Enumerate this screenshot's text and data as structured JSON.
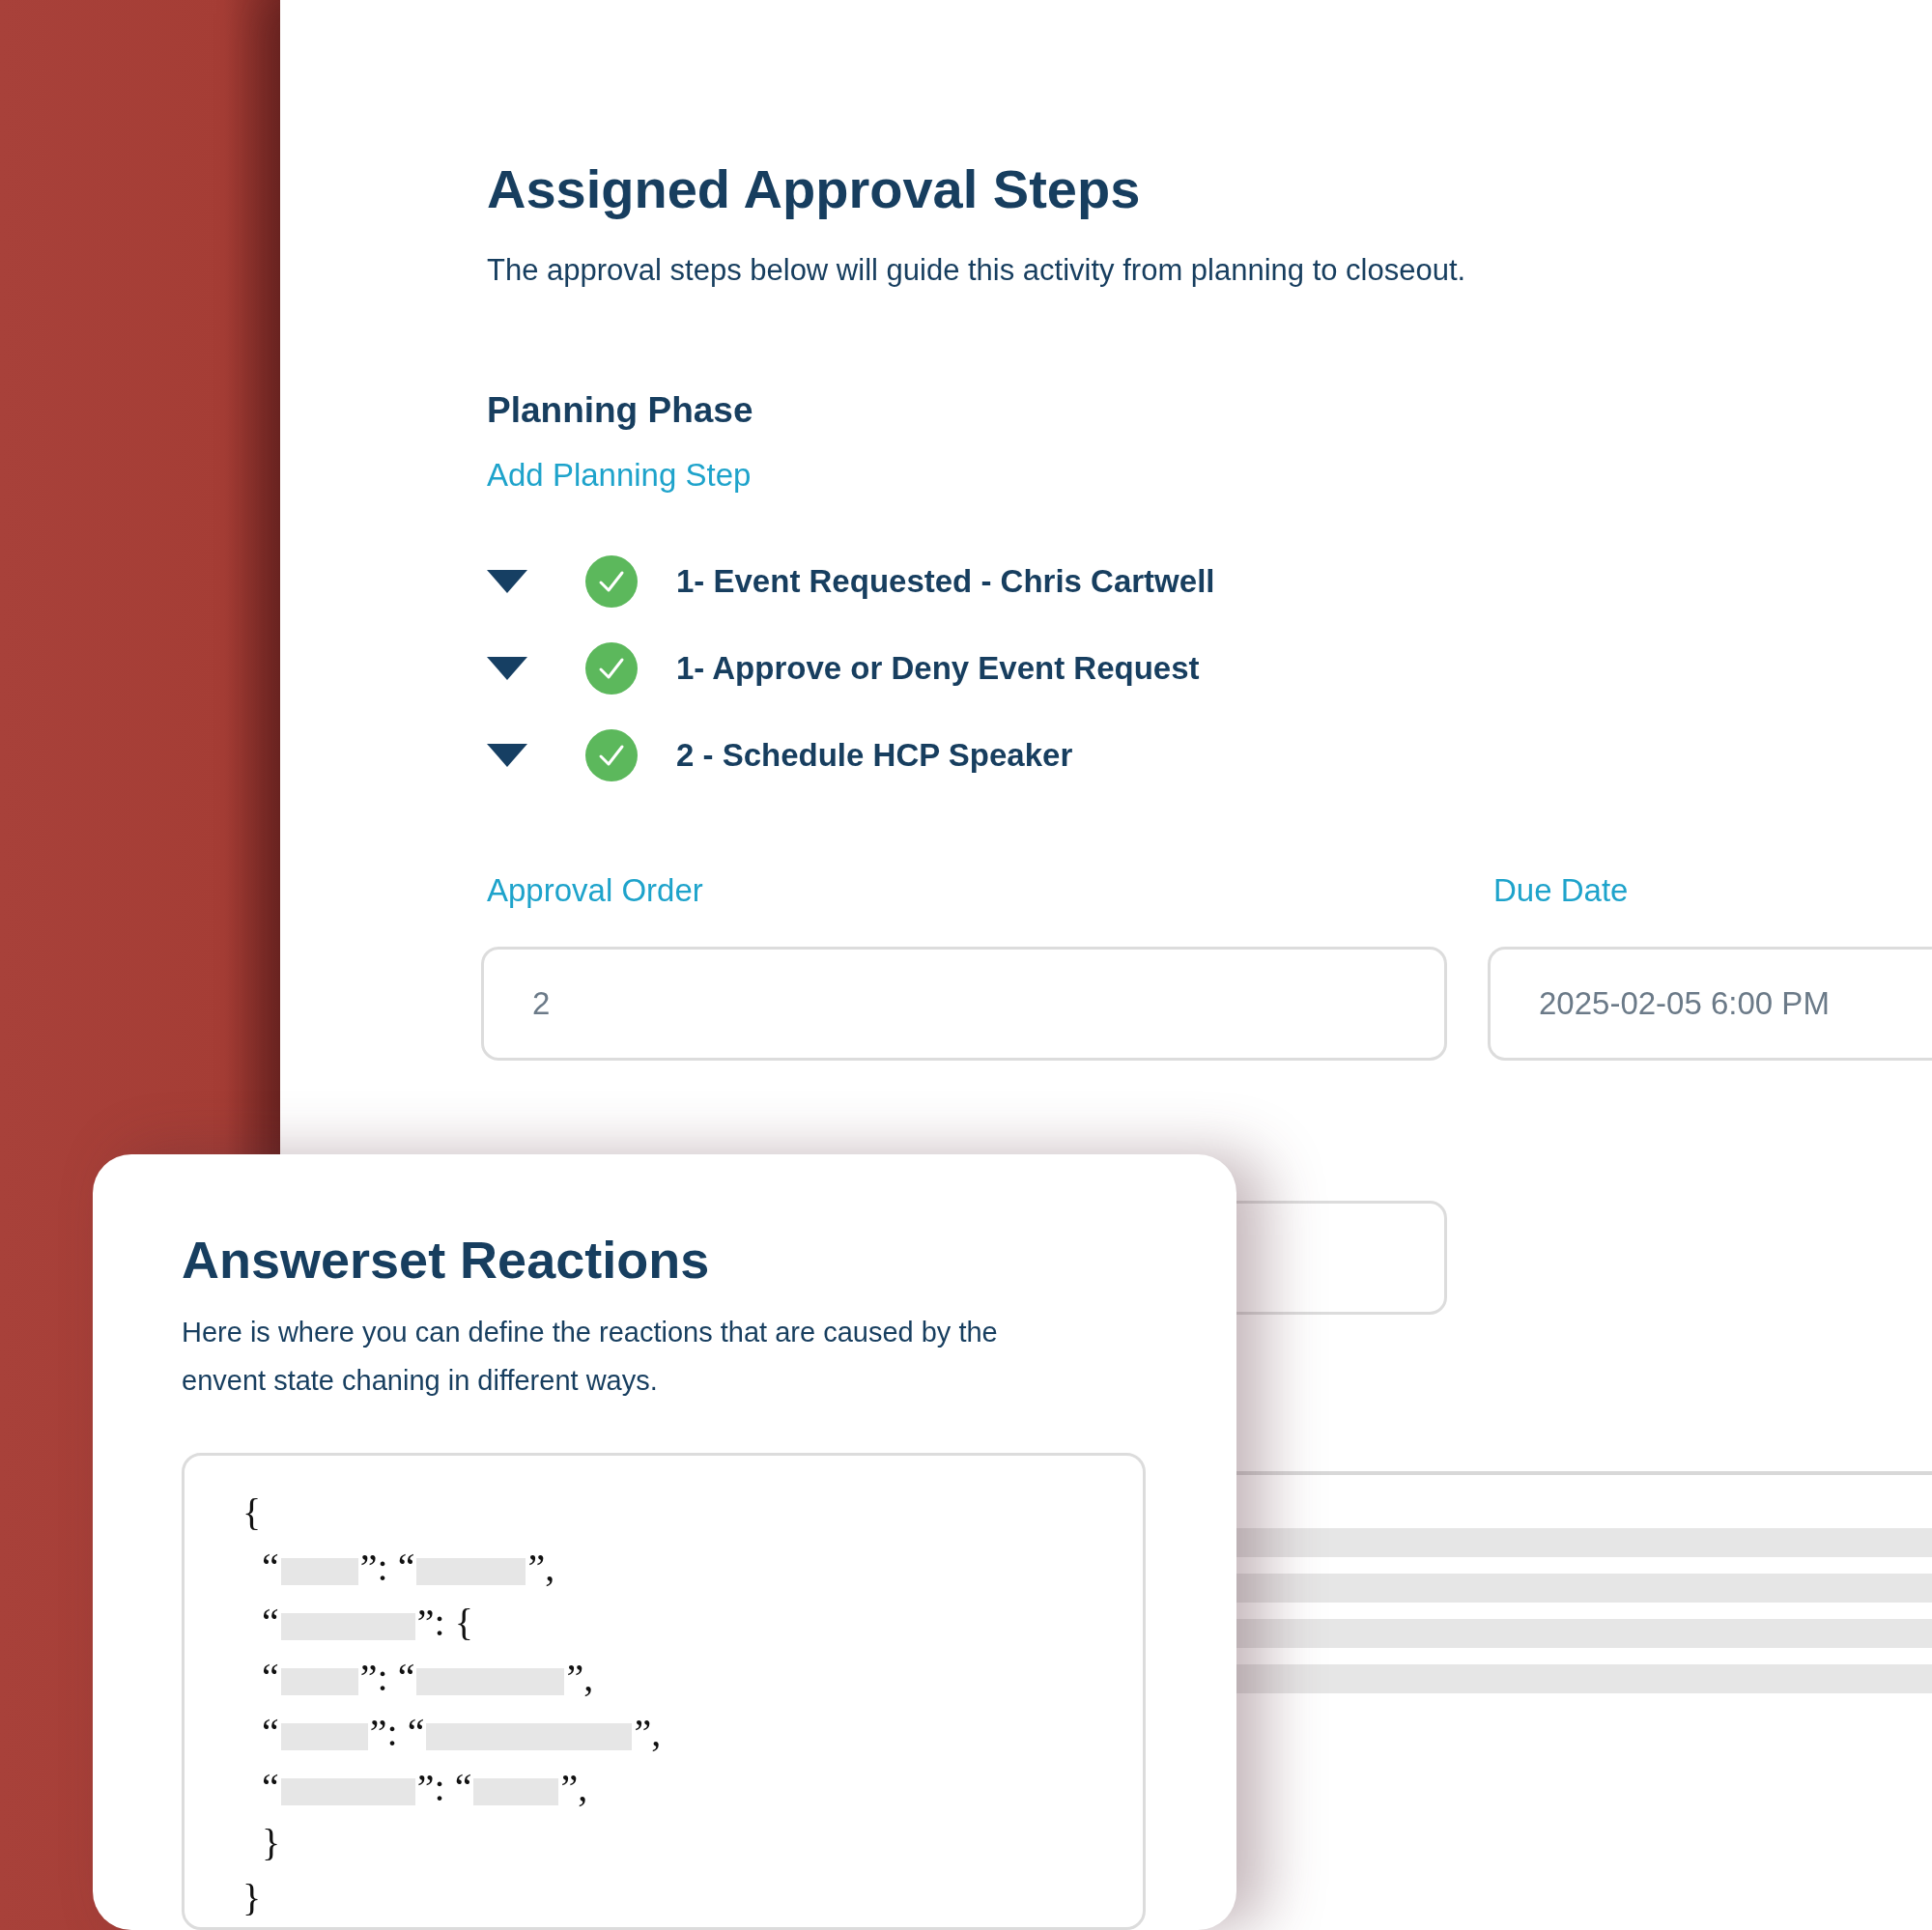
{
  "header": {
    "title": "Assigned Approval Steps",
    "description": "The approval steps below will guide this activity from planning to closeout."
  },
  "phase": {
    "title": "Planning Phase",
    "add_link": "Add Planning Step",
    "steps": [
      {
        "label": "1- Event Requested - Chris Cartwell",
        "completed": true
      },
      {
        "label": "1- Approve or Deny Event Request",
        "completed": true
      },
      {
        "label": "2 - Schedule HCP Speaker",
        "completed": true
      }
    ]
  },
  "form": {
    "fields": [
      {
        "label": "Approval Order",
        "value": "2"
      },
      {
        "label": "Due Date",
        "value": "2025-02-05 6:00 PM"
      }
    ],
    "title_field": {
      "kind": "text"
    }
  },
  "card": {
    "title": "Answerset Reactions",
    "description": "Here is where you can define the reactions that are caused by the envent state chaning in different ways.",
    "code": {
      "open": "{",
      "close": "}",
      "lines": [
        [
          {
            "kind": "text",
            "text": "“"
          },
          {
            "kind": "redacted"
          },
          {
            "kind": "text",
            "text": "”: “"
          },
          {
            "kind": "redacted"
          },
          {
            "kind": "text",
            "text": "”,"
          }
        ],
        [
          {
            "kind": "text",
            "text": "“"
          },
          {
            "kind": "redacted"
          },
          {
            "kind": "text",
            "text": "”: {"
          }
        ],
        [
          {
            "kind": "text",
            "text": "“"
          },
          {
            "kind": "redacted"
          },
          {
            "kind": "text",
            "text": "”: “"
          },
          {
            "kind": "redacted"
          },
          {
            "kind": "text",
            "text": "”,"
          }
        ],
        [
          {
            "kind": "text",
            "text": "“"
          },
          {
            "kind": "redacted"
          },
          {
            "kind": "text",
            "text": "”: “"
          },
          {
            "kind": "redacted"
          },
          {
            "kind": "text",
            "text": "”,"
          }
        ],
        [
          {
            "kind": "text",
            "text": "“"
          },
          {
            "kind": "redacted"
          },
          {
            "kind": "text",
            "text": "”: “"
          },
          {
            "kind": "redacted"
          },
          {
            "kind": "text",
            "text": "”,"
          }
        ],
        [
          {
            "kind": "text",
            "text": "}"
          }
        ]
      ]
    }
  }
}
